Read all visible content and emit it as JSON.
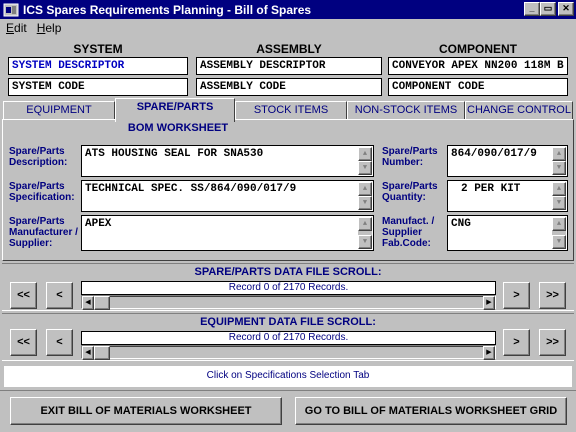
{
  "window": {
    "title": "ICS Spares Requirements Planning - Bill of Spares",
    "minimize_glyph": "_",
    "maximize_glyph": "▭",
    "close_glyph": "✕"
  },
  "menu": {
    "items": [
      "Edit",
      "Help"
    ]
  },
  "header": {
    "system_label": "SYSTEM",
    "assembly_label": "ASSEMBLY",
    "component_label": "COMPONENT",
    "system_descriptor": "SYSTEM DESCRIPTOR",
    "system_code": "SYSTEM CODE",
    "assembly_descriptor": "ASSEMBLY DESCRIPTOR",
    "assembly_code": "ASSEMBLY CODE",
    "component_descriptor": "CONVEYOR APEX NN200 118M B",
    "component_code": "COMPONENT CODE"
  },
  "tabs": {
    "items": [
      "EQUIPMENT",
      "SPARE/PARTS",
      "STOCK ITEMS",
      "NON-STOCK ITEMS",
      "CHANGE CONTROL"
    ],
    "active": "SPARE/PARTS"
  },
  "worksheet": {
    "title": "BOM WORKSHEET",
    "description_label": "Spare/Parts Description:",
    "description_value": "ATS HOUSING SEAL FOR SNA530",
    "specification_label": "Spare/Parts Specification:",
    "specification_value": "TECHNICAL SPEC. SS/864/090/017/9",
    "manufacturer_label": "Spare/Parts Manufacturer / Supplier:",
    "manufacturer_value": "APEX",
    "number_label": "Spare/Parts Number:",
    "number_value": "864/090/017/9",
    "quantity_label": "Spare/Parts Quantity:",
    "quantity_value": "2 PER KIT",
    "fabcode_label": "Manufact. / Supplier Fab.Code:",
    "fabcode_value": "CNG"
  },
  "spare_scroll": {
    "title": "SPARE/PARTS DATA FILE SCROLL:",
    "record_text": "Record 0 of 2170 Records.",
    "first_label": "<<",
    "prev_label": "<",
    "next_label": ">",
    "last_label": ">>"
  },
  "equipment_scroll": {
    "title": "EQUIPMENT DATA FILE SCROLL:",
    "record_text": "Record 0 of 2170 Records.",
    "first_label": "<<",
    "prev_label": "<",
    "next_label": ">",
    "last_label": ">>"
  },
  "status": {
    "text": "Click on Specifications Selection Tab"
  },
  "actions": {
    "exit_label": "EXIT BILL OF MATERIALS WORKSHEET",
    "grid_label": "GO TO BILL OF MATERIALS WORKSHEET GRID"
  },
  "colors": {
    "title_bar": "#000080",
    "label_text": "#000080",
    "face": "#c0c0c0"
  },
  "icons": {
    "scroll_up": "▲",
    "scroll_down": "▼",
    "scroll_left": "◀",
    "scroll_right": "▶"
  }
}
